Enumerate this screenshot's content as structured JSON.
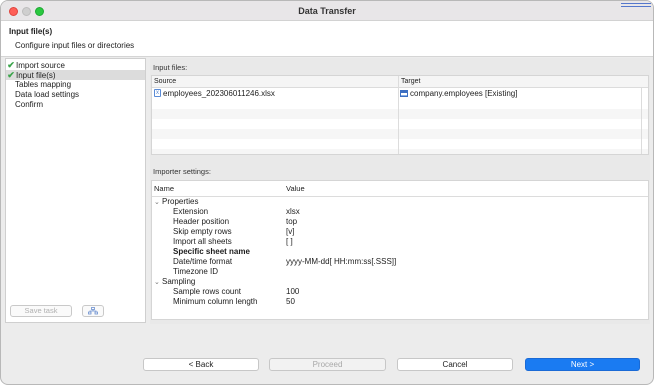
{
  "window": {
    "title": "Data Transfer"
  },
  "header": {
    "title": "Input file(s)",
    "subtitle": "Configure input files or directories"
  },
  "nav": {
    "items": [
      {
        "label": "Import source",
        "checked": true,
        "selected": false
      },
      {
        "label": "Input file(s)",
        "checked": true,
        "selected": true
      },
      {
        "label": "Tables mapping",
        "checked": false,
        "selected": false
      },
      {
        "label": "Data load settings",
        "checked": false,
        "selected": false
      },
      {
        "label": "Confirm",
        "checked": false,
        "selected": false
      }
    ],
    "save_task_label": "Save task",
    "task_icon": "task-scheduler-icon"
  },
  "input_files": {
    "label": "Input files:",
    "columns": [
      "Source",
      "Target"
    ],
    "rows": [
      {
        "source": "employees_202306011246.xlsx",
        "target": "company.employees [Existing]"
      }
    ]
  },
  "importer_settings": {
    "label": "Importer settings:",
    "columns": [
      "Name",
      "Value"
    ],
    "groups": [
      {
        "name": "Properties",
        "properties": [
          {
            "name": "Extension",
            "value": "xlsx"
          },
          {
            "name": "Header position",
            "value": "top"
          },
          {
            "name": "Skip empty rows",
            "value": "[v]"
          },
          {
            "name": "Import all sheets",
            "value": "[ ]"
          },
          {
            "name": "Specific sheet name",
            "value": ""
          },
          {
            "name": "Date/time format",
            "value": "yyyy-MM-dd[ HH:mm:ss[.SSS]]"
          },
          {
            "name": "Timezone ID",
            "value": ""
          }
        ]
      },
      {
        "name": "Sampling",
        "properties": [
          {
            "name": "Sample rows count",
            "value": "100"
          },
          {
            "name": "Minimum column length",
            "value": "50"
          }
        ]
      }
    ]
  },
  "footer": {
    "back_label": "< Back",
    "proceed_label": "Proceed",
    "cancel_label": "Cancel",
    "next_label": "Next >"
  },
  "colors": {
    "accent": "#1a7bf2",
    "check": "#3aa44a",
    "selection": "#dcdcdc"
  }
}
